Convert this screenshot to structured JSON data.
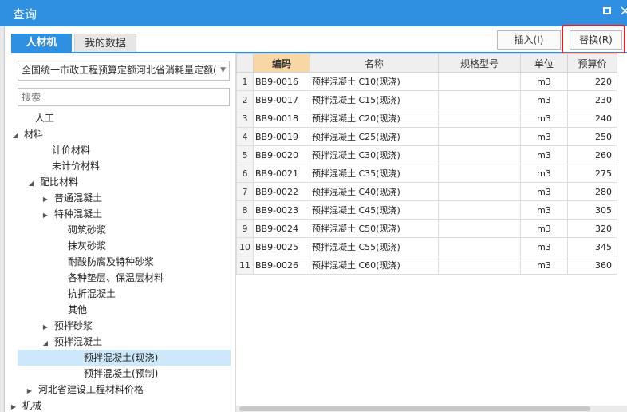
{
  "window": {
    "title": "查询",
    "maximize_icon": "maximize-icon",
    "close_icon": "close-icon",
    "close_glyph": "×"
  },
  "tabs": [
    {
      "label": "人材机"
    },
    {
      "label": "我的数据"
    }
  ],
  "toolbar": {
    "insert_label": "插入(I)",
    "replace_label": "替换(R)"
  },
  "left": {
    "library_value": "全国统一市政工程预算定额河北省消耗量定额(",
    "search_placeholder": "搜索",
    "tree": [
      {
        "label": "人工",
        "arrow": ""
      },
      {
        "label": "材料",
        "arrow": "◢"
      },
      {
        "label": "计价材料",
        "arrow": ""
      },
      {
        "label": "未计价材料",
        "arrow": ""
      },
      {
        "label": "配比材料",
        "arrow": "◢"
      },
      {
        "label": "普通混凝土",
        "arrow": "▶"
      },
      {
        "label": "特种混凝土",
        "arrow": "▶"
      },
      {
        "label": "砌筑砂浆",
        "arrow": ""
      },
      {
        "label": "抹灰砂浆",
        "arrow": ""
      },
      {
        "label": "耐酸防腐及特种砂浆",
        "arrow": ""
      },
      {
        "label": "各种垫层、保温层材料",
        "arrow": ""
      },
      {
        "label": "抗折混凝土",
        "arrow": ""
      },
      {
        "label": "其他",
        "arrow": ""
      },
      {
        "label": "预拌砂浆",
        "arrow": "▶"
      },
      {
        "label": "预拌混凝土",
        "arrow": "◢"
      },
      {
        "label": "预拌混凝土(现浇)",
        "arrow": ""
      },
      {
        "label": "预拌混凝土(预制)",
        "arrow": ""
      },
      {
        "label": "河北省建设工程材料价格",
        "arrow": "▶"
      },
      {
        "label": "机械",
        "arrow": "▶"
      }
    ]
  },
  "table": {
    "columns": [
      "",
      "编码",
      "名称",
      "规格型号",
      "单位",
      "预算价"
    ],
    "rows": [
      [
        "1",
        "BB9-0016",
        "预拌混凝土 C10(现浇)",
        "",
        "m3",
        "220"
      ],
      [
        "2",
        "BB9-0017",
        "预拌混凝土 C15(现浇)",
        "",
        "m3",
        "230"
      ],
      [
        "3",
        "BB9-0018",
        "预拌混凝土 C20(现浇)",
        "",
        "m3",
        "240"
      ],
      [
        "4",
        "BB9-0019",
        "预拌混凝土 C25(现浇)",
        "",
        "m3",
        "250"
      ],
      [
        "5",
        "BB9-0020",
        "预拌混凝土 C30(现浇)",
        "",
        "m3",
        "260"
      ],
      [
        "6",
        "BB9-0021",
        "预拌混凝土 C35(现浇)",
        "",
        "m3",
        "275"
      ],
      [
        "7",
        "BB9-0022",
        "预拌混凝土 C40(现浇)",
        "",
        "m3",
        "280"
      ],
      [
        "8",
        "BB9-0023",
        "预拌混凝土 C45(现浇)",
        "",
        "m3",
        "305"
      ],
      [
        "9",
        "BB9-0024",
        "预拌混凝土 C50(现浇)",
        "",
        "m3",
        "320"
      ],
      [
        "10",
        "BB9-0025",
        "预拌混凝土 C55(现浇)",
        "",
        "m3",
        "345"
      ],
      [
        "11",
        "BB9-0026",
        "预拌混凝土 C60(现浇)",
        "",
        "m3",
        "360"
      ]
    ]
  }
}
